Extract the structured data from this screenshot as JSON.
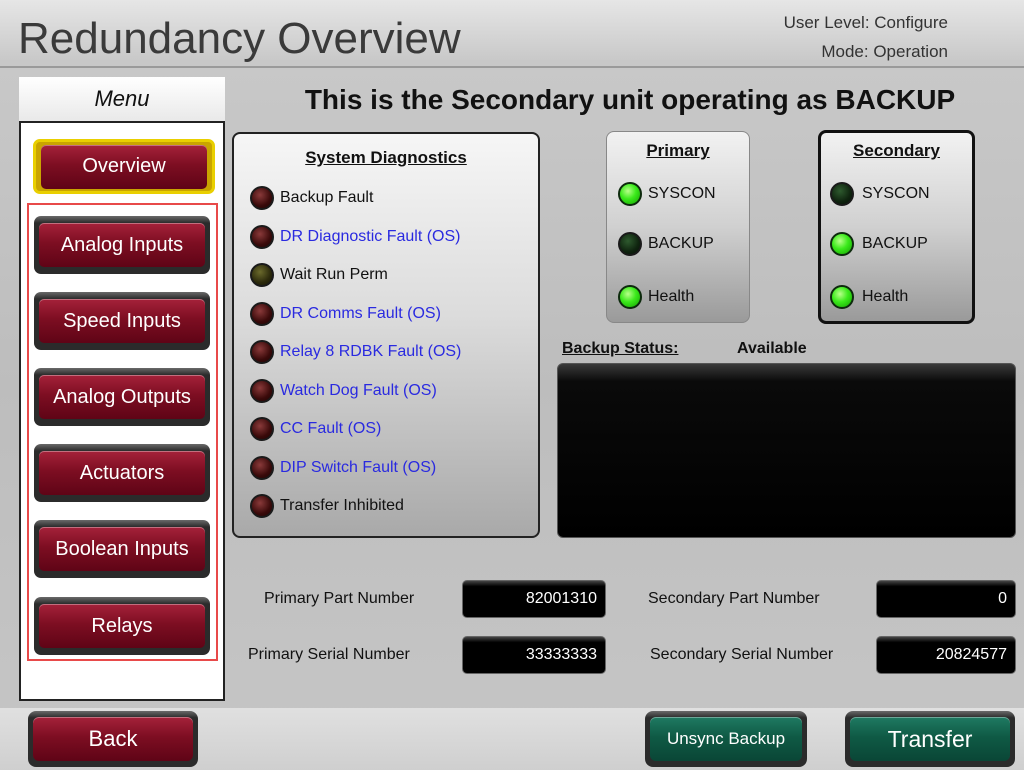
{
  "header": {
    "title": "Redundancy Overview",
    "user_level": "User Level: Configure",
    "mode": "Mode: Operation"
  },
  "menu": {
    "title": "Menu",
    "items": [
      {
        "label": "Overview",
        "active": true
      },
      {
        "label": "Analog Inputs"
      },
      {
        "label": "Speed Inputs"
      },
      {
        "label": "Analog Outputs"
      },
      {
        "label": "Actuators"
      },
      {
        "label": "Boolean Inputs"
      },
      {
        "label": "Relays"
      }
    ]
  },
  "headline": "This is the Secondary unit operating as BACKUP",
  "diagnostics": {
    "title": "System Diagnostics",
    "items": [
      {
        "label": "Backup Fault",
        "color": "#111111",
        "led": "dark-red"
      },
      {
        "label": "DR Diagnostic Fault (OS)",
        "color": "#2a2ae0",
        "led": "dark-red"
      },
      {
        "label": "Wait Run Perm",
        "color": "#111111",
        "led": "dark-olive"
      },
      {
        "label": "DR Comms Fault (OS)",
        "color": "#2a2ae0",
        "led": "dark-red"
      },
      {
        "label": "Relay 8 RDBK Fault (OS)",
        "color": "#2a2ae0",
        "led": "dark-red"
      },
      {
        "label": "Watch Dog Fault (OS)",
        "color": "#2a2ae0",
        "led": "dark-red"
      },
      {
        "label": "CC Fault (OS)",
        "color": "#2a2ae0",
        "led": "dark-red"
      },
      {
        "label": "DIP Switch Fault (OS)",
        "color": "#2a2ae0",
        "led": "dark-red"
      },
      {
        "label": "Transfer Inhibited",
        "color": "#111111",
        "led": "dark-red"
      }
    ]
  },
  "primary": {
    "title": "Primary",
    "indicators": [
      {
        "label": "SYSCON",
        "state": "on"
      },
      {
        "label": "BACKUP",
        "state": "off"
      },
      {
        "label": "Health",
        "state": "on"
      }
    ]
  },
  "secondary": {
    "title": "Secondary",
    "indicators": [
      {
        "label": "SYSCON",
        "state": "off"
      },
      {
        "label": "BACKUP",
        "state": "on"
      },
      {
        "label": "Health",
        "state": "on"
      }
    ]
  },
  "backup_status": {
    "label": "Backup Status:",
    "value": "Available"
  },
  "fields": {
    "primary_part_label": "Primary Part Number",
    "primary_part_value": "82001310",
    "primary_serial_label": "Primary Serial Number",
    "primary_serial_value": "33333333",
    "secondary_part_label": "Secondary Part Number",
    "secondary_part_value": "0",
    "secondary_serial_label": "Secondary Serial Number",
    "secondary_serial_value": "20824577"
  },
  "footer": {
    "back_label": "Back",
    "unsync_label": "Unsync Backup",
    "transfer_label": "Transfer"
  }
}
